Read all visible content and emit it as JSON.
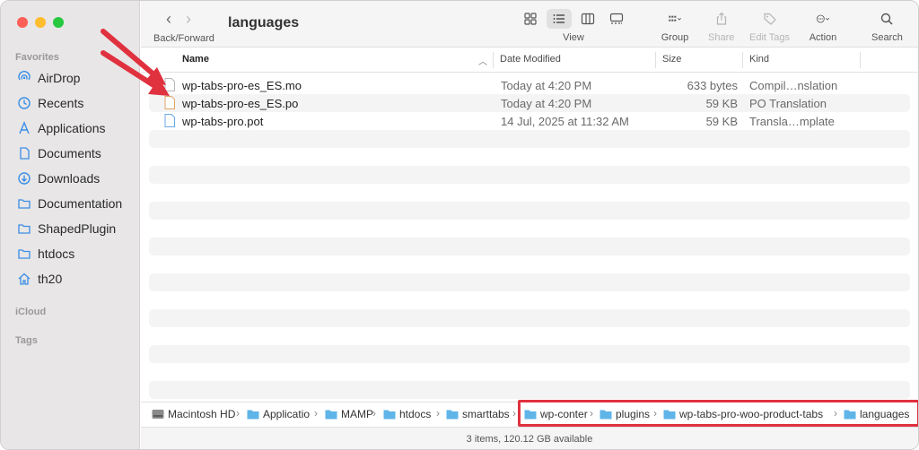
{
  "sidebar": {
    "sections": {
      "favorites": "Favorites",
      "icloud": "iCloud",
      "tags": "Tags"
    },
    "items": [
      {
        "label": "AirDrop",
        "icon": "airdrop-icon"
      },
      {
        "label": "Recents",
        "icon": "clock-icon"
      },
      {
        "label": "Applications",
        "icon": "applications-icon"
      },
      {
        "label": "Documents",
        "icon": "document-icon"
      },
      {
        "label": "Downloads",
        "icon": "download-icon"
      },
      {
        "label": "Documentation",
        "icon": "folder-icon"
      },
      {
        "label": "ShapedPlugin",
        "icon": "folder-icon"
      },
      {
        "label": "htdocs",
        "icon": "folder-icon"
      },
      {
        "label": "th20",
        "icon": "home-icon"
      }
    ]
  },
  "toolbar": {
    "title": "languages",
    "back_forward_label": "Back/Forward",
    "view_label": "View",
    "group_label": "Group",
    "share_label": "Share",
    "edit_tags_label": "Edit Tags",
    "action_label": "Action",
    "search_label": "Search"
  },
  "columns": {
    "name": "Name",
    "date_modified": "Date Modified",
    "size": "Size",
    "kind": "Kind"
  },
  "files": [
    {
      "name": "wp-tabs-pro-es_ES.mo",
      "date": "Today at 4:20 PM",
      "size": "633 bytes",
      "kind": "Compil…nslation"
    },
    {
      "name": "wp-tabs-pro-es_ES.po",
      "date": "Today at 4:20 PM",
      "size": "59 KB",
      "kind": "PO Translation"
    },
    {
      "name": "wp-tabs-pro.pot",
      "date": "14 Jul, 2025 at 11:32 AM",
      "size": "59 KB",
      "kind": "Transla…mplate"
    }
  ],
  "pathbar": [
    "Macintosh HD",
    "Applicatio",
    "MAMP",
    "htdocs",
    "smarttabs",
    "wp-conter",
    "plugins",
    "wp-tabs-pro-woo-product-tabs",
    "languages"
  ],
  "status": "3 items, 120.12 GB available",
  "colors": {
    "accent": "#3a8ee6",
    "highlight": "#e0313f",
    "folder": "#5fb4e8"
  }
}
